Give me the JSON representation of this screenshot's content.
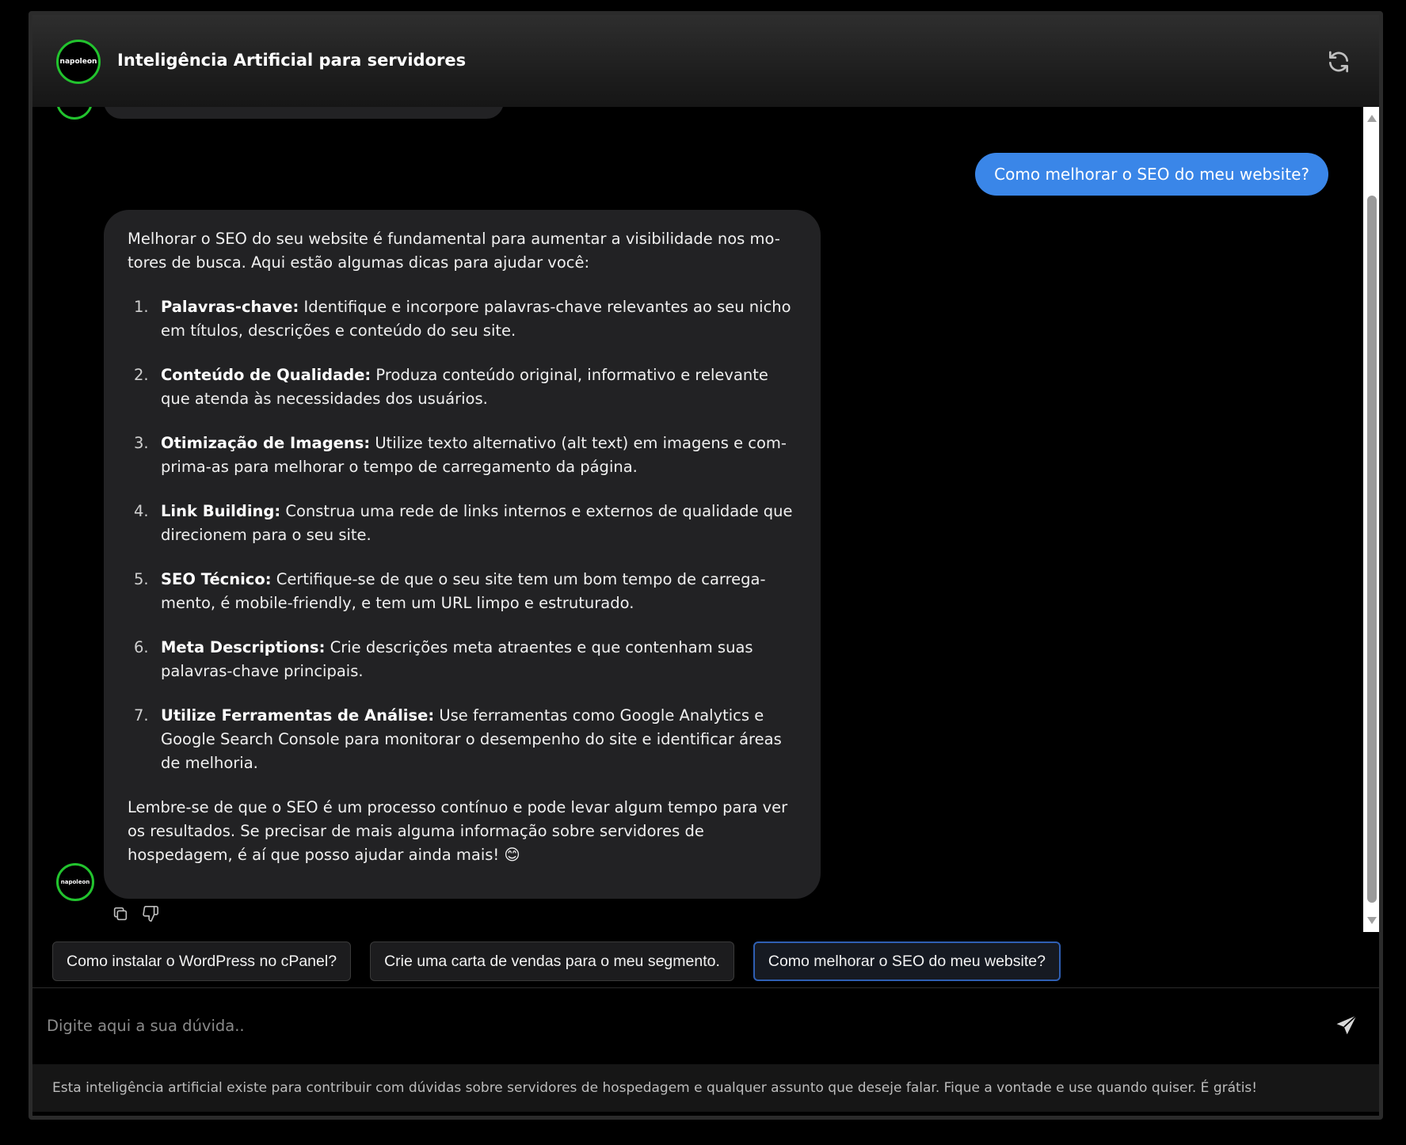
{
  "header": {
    "logo_text": "napoleon",
    "title": "Inteligência Artificial para servidores",
    "refresh_icon": "refresh-icon"
  },
  "messages": {
    "user": "Como melhorar o SEO do meu website?",
    "bot": {
      "avatar_text": "napoleon",
      "intro": "Melhorar o SEO do seu website é fundamental para aumentar a visibilidade nos mo-tores de busca. Aqui estão algumas dicas para ajudar você:",
      "items": [
        {
          "num": "1.",
          "title": "Palavras-chave:",
          "text": " Identifique e incorpore palavras-chave relevantes ao seu nicho em títulos, descrições e conteúdo do seu site."
        },
        {
          "num": "2.",
          "title": "Conteúdo de Qualidade:",
          "text": " Produza conteúdo original, informativo e relevante que atenda às necessidades dos usuários."
        },
        {
          "num": "3.",
          "title": "Otimização de Imagens:",
          "text": " Utilize texto alternativo (alt text) em imagens e com-prima-as para melhorar o tempo de carregamento da página."
        },
        {
          "num": "4.",
          "title": "Link Building:",
          "text": " Construa uma rede de links internos e externos de qualidade que direcionem para o seu site."
        },
        {
          "num": "5.",
          "title": "SEO Técnico:",
          "text": " Certifique-se de que o seu site tem um bom tempo de carrega-mento, é mobile-friendly, e tem um URL limpo e estruturado."
        },
        {
          "num": "6.",
          "title": "Meta Descriptions:",
          "text": " Crie descrições meta atraentes e que contenham suas palavras-chave principais."
        },
        {
          "num": "7.",
          "title": "Utilize Ferramentas de Análise:",
          "text": " Use ferramentas como Google Analytics e Google Search Console para monitorar o desempenho do site e identificar áreas de melhoria."
        }
      ],
      "outro": "Lembre-se de que o SEO é um processo contínuo e pode levar algum tempo para ver os resultados. Se precisar de mais alguma informação sobre servidores de hospedagem, é aí que posso ajudar ainda mais! 😊",
      "actions": [
        "copy-icon",
        "thumbs-down-icon"
      ]
    }
  },
  "suggestions": [
    "Como instalar o WordPress no cPanel?",
    "Crie uma carta de vendas para o meu segmento.",
    "Como melhorar o SEO do meu website?"
  ],
  "input": {
    "placeholder": "Digite aqui a sua dúvida..",
    "value": "",
    "send_icon": "send-icon"
  },
  "footer": {
    "text": "Esta inteligência artificial existe para contribuir com dúvidas sobre servidores de hospedagem e qualquer assunto que deseje falar. Fique a vontade e use quando quiser. É grátis!"
  },
  "colors": {
    "accent": "#3a86e8",
    "avatar_ring": "#22c32e",
    "bubble": "#222224"
  }
}
